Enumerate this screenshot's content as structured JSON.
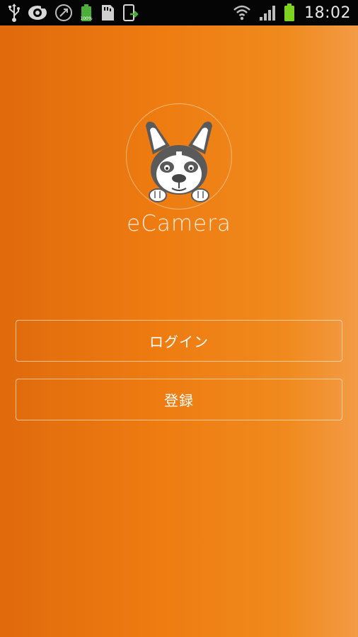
{
  "status_bar": {
    "time": "18:02",
    "left_icons": [
      "usb-icon",
      "camera-app-icon",
      "sync-icon",
      "battery-full-icon",
      "sd-card-icon",
      "screen-share-icon"
    ],
    "right_icons": [
      "wifi-icon",
      "signal-icon",
      "battery-icon"
    ],
    "battery_badge": "100%",
    "background_color": "#050505"
  },
  "app": {
    "name": "eCamera",
    "gradient_colors": [
      "#e06a0c",
      "#ee7c11",
      "#f29b45"
    ]
  },
  "buttons": {
    "login_label": "ログイン",
    "register_label": "登録"
  }
}
